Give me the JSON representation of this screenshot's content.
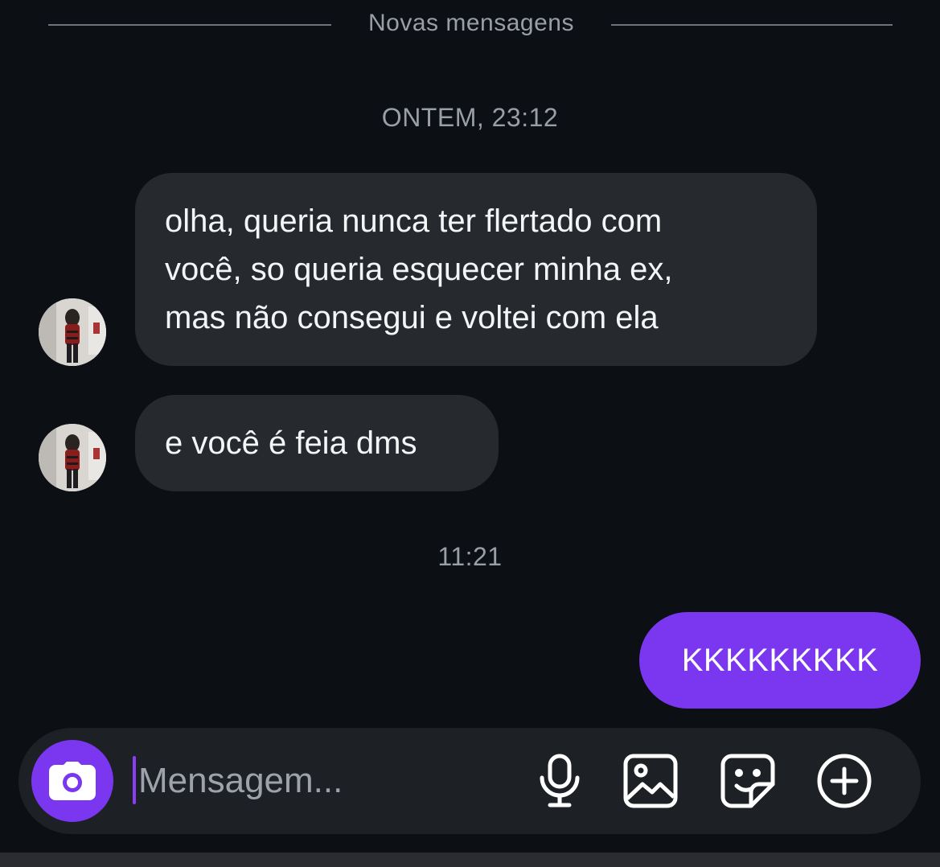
{
  "chat": {
    "new_messages_label": "Novas mensagens",
    "timestamp_1": "ONTEM, 23:12",
    "timestamp_2": "11:21",
    "received": [
      {
        "lines": [
          "olha, queria nunca ter flertado com",
          "você, so queria esquecer minha ex,",
          "mas não consegui e voltei com ela"
        ]
      },
      {
        "lines": [
          "e você é feia dms"
        ]
      }
    ],
    "sent": [
      {
        "text": "KKKKKKKKK"
      }
    ]
  },
  "composer": {
    "placeholder": "Mensagem...",
    "camera_icon": "camera-icon",
    "mic_icon": "microphone-icon",
    "gallery_icon": "image-icon",
    "sticker_icon": "sticker-icon",
    "more_icon": "plus-circle-icon"
  },
  "colors": {
    "background": "#0c0f14",
    "received_bubble": "#26292e",
    "sent_bubble": "#7b37f0",
    "accent": "#7b37f0",
    "muted_text": "#9a9ea6"
  }
}
